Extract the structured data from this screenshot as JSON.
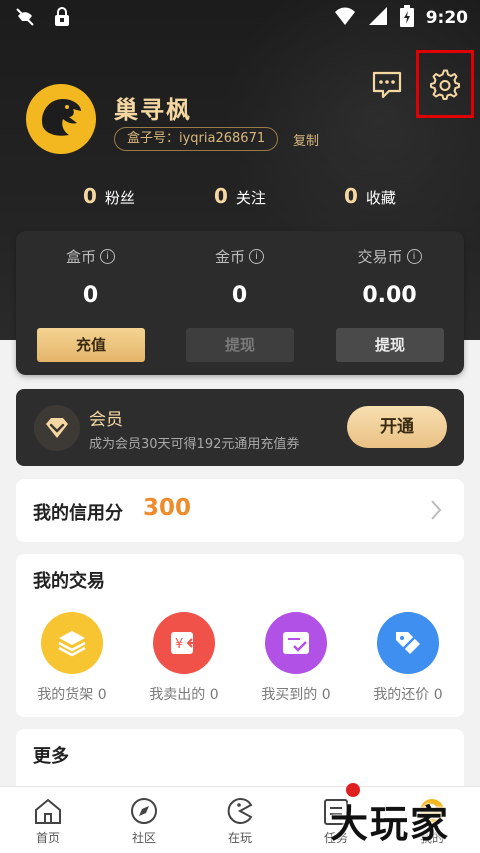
{
  "status_bar": {
    "time": "9:20"
  },
  "profile": {
    "username": "巢寻枫",
    "box_id": "盒子号：iyqria268671",
    "copy_label": "复制"
  },
  "stats": [
    {
      "value": "0",
      "label": "粉丝"
    },
    {
      "value": "0",
      "label": "关注"
    },
    {
      "value": "0",
      "label": "收藏"
    }
  ],
  "wallet": [
    {
      "title": "盒币",
      "value": "0",
      "button": "充值"
    },
    {
      "title": "金币",
      "value": "0",
      "button": "提现"
    },
    {
      "title": "交易币",
      "value": "0.00",
      "button": "提现"
    }
  ],
  "member": {
    "title": "会员",
    "subtitle": "成为会员30天可得192元通用充值券",
    "button": "开通"
  },
  "credit": {
    "label": "我的信用分",
    "value": "300"
  },
  "trade": {
    "title": "我的交易",
    "items": [
      {
        "label": "我的货架 0",
        "icon": "shelf-icon",
        "color": "#f7c531"
      },
      {
        "label": "我卖出的 0",
        "icon": "sold-icon",
        "color": "#f0524a"
      },
      {
        "label": "我买到的 0",
        "icon": "bought-icon",
        "color": "#b251e6"
      },
      {
        "label": "我的还价 0",
        "icon": "price-tag-icon",
        "color": "#3f8ff0"
      }
    ]
  },
  "more": {
    "title": "更多"
  },
  "bottom_nav": [
    {
      "label": "首页",
      "icon": "home-icon"
    },
    {
      "label": "社区",
      "icon": "compass-icon"
    },
    {
      "label": "在玩",
      "icon": "game-icon"
    },
    {
      "label": "任务",
      "icon": "task-icon"
    },
    {
      "label": "我的",
      "icon": "profile-icon"
    }
  ],
  "watermark": "大玩家"
}
